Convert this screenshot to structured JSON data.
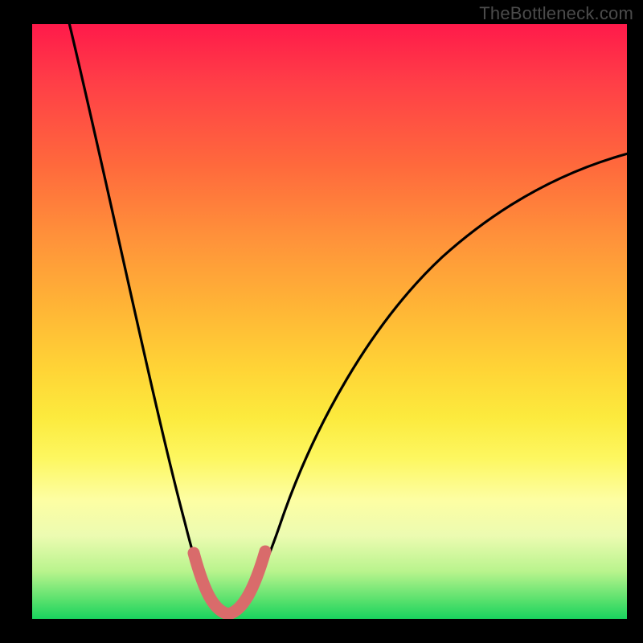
{
  "watermark": "TheBottleneck.com",
  "colors": {
    "background": "#000000",
    "curve": "#000000",
    "highlight": "#d96b6b",
    "gradient_stops": [
      "#ff1a4a",
      "#ff3f47",
      "#ff6a3c",
      "#ff923a",
      "#ffb636",
      "#ffd436",
      "#fcea3d",
      "#fdf760",
      "#fdfea3",
      "#ecfbb1",
      "#b9f48d",
      "#55e06c",
      "#19d35e"
    ]
  },
  "chart_data": {
    "type": "line",
    "title": "",
    "xlabel": "",
    "ylabel": "",
    "xlim": [
      0,
      100
    ],
    "ylim": [
      0,
      100
    ],
    "curve_points": [
      {
        "x": 6,
        "y": 100
      },
      {
        "x": 10,
        "y": 85
      },
      {
        "x": 15,
        "y": 63
      },
      {
        "x": 20,
        "y": 42
      },
      {
        "x": 24,
        "y": 24
      },
      {
        "x": 27,
        "y": 11
      },
      {
        "x": 29,
        "y": 4
      },
      {
        "x": 31,
        "y": 1
      },
      {
        "x": 33,
        "y": 0.5
      },
      {
        "x": 35,
        "y": 1
      },
      {
        "x": 37,
        "y": 4
      },
      {
        "x": 40,
        "y": 12
      },
      {
        "x": 45,
        "y": 26
      },
      {
        "x": 52,
        "y": 41
      },
      {
        "x": 60,
        "y": 53
      },
      {
        "x": 70,
        "y": 63
      },
      {
        "x": 80,
        "y": 70
      },
      {
        "x": 90,
        "y": 75
      },
      {
        "x": 100,
        "y": 78
      }
    ],
    "highlight_range_x": [
      27,
      39
    ],
    "minimum_x": 33
  }
}
